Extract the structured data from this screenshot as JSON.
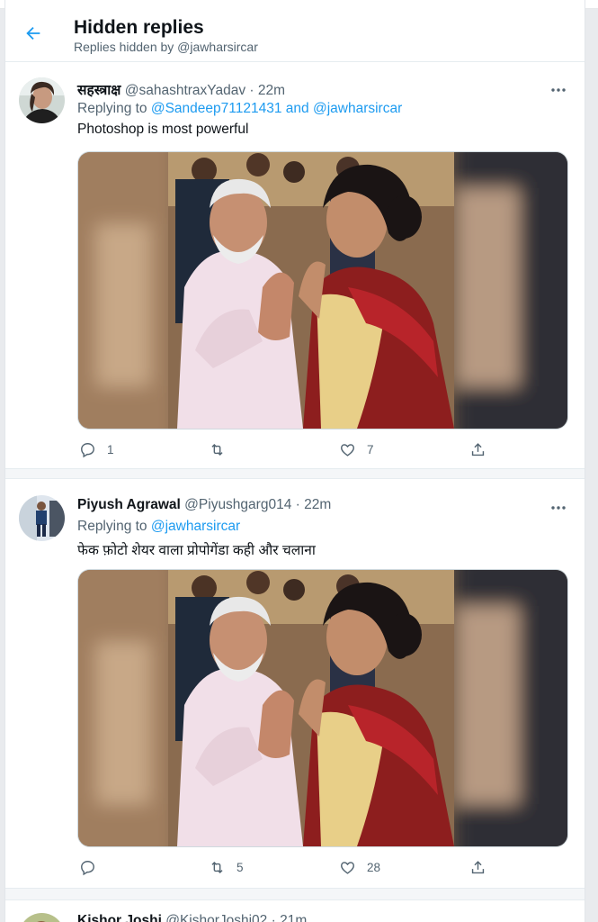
{
  "header": {
    "title": "Hidden replies",
    "subtitle": "Replies hidden by @jawharsircar"
  },
  "tweets": [
    {
      "name": "सहस्त्राक्ष",
      "handle": "@sahashtraxYadav",
      "time": "22m",
      "replying_prefix": "Replying to",
      "mentions": [
        "@Sandeep71121431",
        "@jawharsircar"
      ],
      "mention_joiner": "and",
      "text": "Photoshop is most powerful",
      "replies": "1",
      "retweets": "",
      "likes": "7"
    },
    {
      "name": "Piyush Agrawal",
      "handle": "@Piyushgarg014",
      "time": "22m",
      "replying_prefix": "Replying to",
      "mentions": [
        "@jawharsircar"
      ],
      "text": "फेक फ़ोटो शेयर वाला प्रोपोगेंडा कही और चलाना",
      "replies": "",
      "retweets": "5",
      "likes": "28"
    },
    {
      "name": "Kishor Joshi",
      "handle": "@KishorJoshi02",
      "time": "21m"
    }
  ],
  "colors": {
    "accent": "#1d9bf0",
    "muted": "#536471",
    "text": "#0f1419"
  },
  "icons": [
    "back-arrow-icon",
    "more-icon",
    "reply-icon",
    "retweet-icon",
    "like-icon",
    "share-icon"
  ]
}
